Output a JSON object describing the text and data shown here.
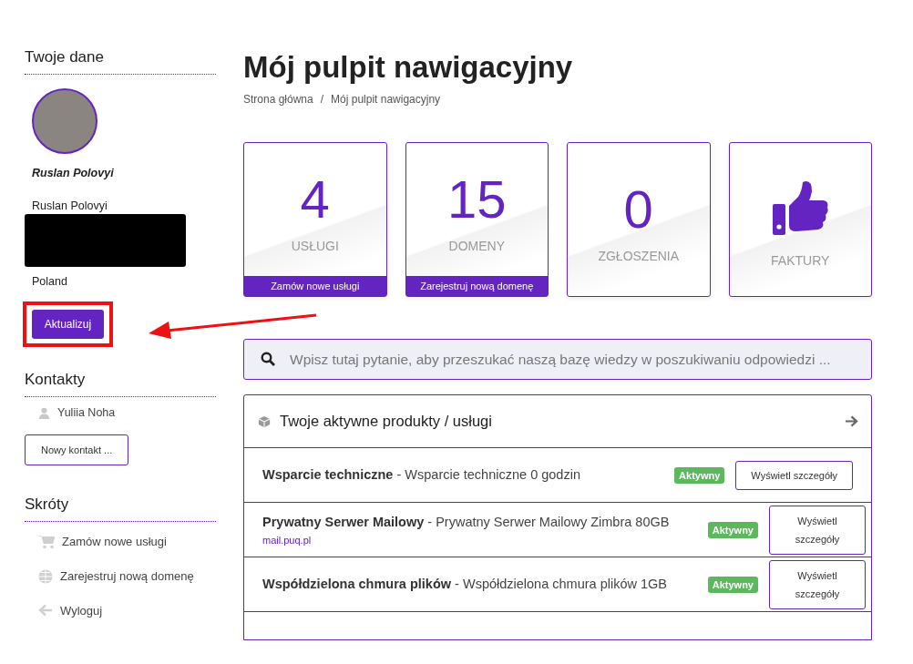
{
  "sidebar": {
    "profile": {
      "heading": "Twoje dane",
      "display_name": "Ruslan Polovyi",
      "full_name": "Ruslan Polovyi",
      "country": "Poland",
      "update_button": "Aktualizuj"
    },
    "contacts": {
      "heading": "Kontakty",
      "items": [
        "Yuliia Noha"
      ],
      "new_button": "Nowy kontakt ..."
    },
    "shortcuts": {
      "heading": "Skróty",
      "items": [
        {
          "kind": "cart",
          "label": "Zamów nowe usługi"
        },
        {
          "kind": "globe",
          "label": "Zarejestruj nową domenę"
        },
        {
          "kind": "logout",
          "label": "Wyloguj"
        }
      ]
    }
  },
  "page": {
    "title": "Mój pulpit nawigacyjny",
    "breadcrumbs": [
      "Strona główna",
      "Mój pulpit nawigacyjny"
    ],
    "breadcrumb_separator": "/"
  },
  "tiles": [
    {
      "kind": "count",
      "value": "4",
      "label": "USŁUGI",
      "action": "Zamów nowe usługi"
    },
    {
      "kind": "count",
      "value": "15",
      "label": "DOMENY",
      "action": "Zarejestruj nową domenę"
    },
    {
      "kind": "count",
      "value": "0",
      "label": "ZGŁOSZENIA"
    },
    {
      "kind": "thumb",
      "label": "FAKTURY"
    }
  ],
  "search": {
    "placeholder": "Wpisz tutaj pytanie, aby przeszukać naszą bazę wiedzy w poszukiwaniu odpowiedzi ..."
  },
  "products": {
    "title": "Twoje aktywne produkty / usługi",
    "rows": [
      {
        "name": "Wsparcie techniczne",
        "description": " - Wsparcie techniczne 0 godzin",
        "status": "Aktywny",
        "button": "Wyświetl szczegóły"
      },
      {
        "name": "Prywatny Serwer Mailowy",
        "description": " - Prywatny Serwer Mailowy Zimbra 80GB",
        "domain": "mail.puq.pl",
        "status": "Aktywny",
        "button": "Wyświetl szczegóły"
      },
      {
        "name": "Współdzielona chmura plików",
        "description": " - Współdzielona chmura plików 1GB",
        "status": "Aktywny",
        "button": "Wyświetl szczegóły"
      }
    ]
  }
}
